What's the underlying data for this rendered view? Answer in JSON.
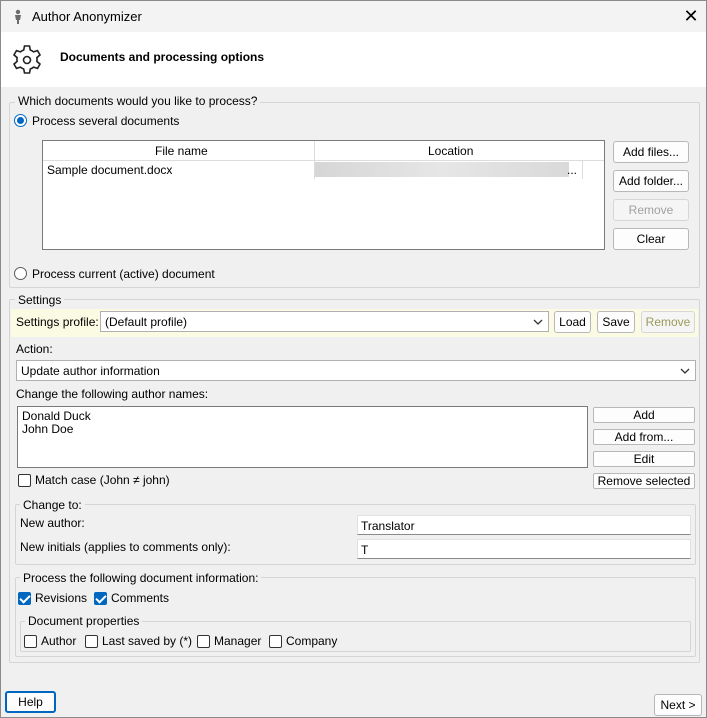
{
  "window": {
    "title": "Author Anonymizer",
    "close_glyph": "✕"
  },
  "header": {
    "title": "Documents and processing options",
    "icon": "gear-icon"
  },
  "docs_group": {
    "label": "Which documents would you like to process?",
    "option_several": "Process several documents",
    "option_current": "Process current (active) document",
    "table": {
      "columns": [
        "File name",
        "Location"
      ],
      "rows": [
        {
          "file": "Sample document.docx",
          "location_suffix": "..."
        }
      ]
    },
    "buttons": {
      "add_files": "Add files...",
      "add_folder": "Add folder...",
      "remove": "Remove",
      "clear": "Clear"
    }
  },
  "settings_group": {
    "label": "Settings",
    "profile_label": "Settings profile:",
    "profile_value": "(Default profile)",
    "load": "Load",
    "save": "Save",
    "remove": "Remove",
    "action_label": "Action:",
    "action_value": "Update author information",
    "names_label": "Change the following author names:",
    "names": [
      "Donald Duck",
      "John Doe"
    ],
    "names_buttons": {
      "add": "Add",
      "add_from": "Add from...",
      "edit": "Edit",
      "remove_selected": "Remove selected"
    },
    "match_case": "Match case (John ≠ john)"
  },
  "change_to": {
    "label": "Change to:",
    "new_author_label": "New author:",
    "new_author_value": "Translator",
    "new_initials_label": "New initials (applies to comments only):",
    "new_initials_value": "T"
  },
  "process_info": {
    "label": "Process the following document information:",
    "revisions": "Revisions",
    "comments": "Comments",
    "doc_props_label": "Document properties",
    "author": "Author",
    "last_saved_by": "Last saved by (*)",
    "manager": "Manager",
    "company": "Company"
  },
  "footer": {
    "help": "Help",
    "next": "Next >"
  },
  "colors": {
    "accent": "#0067c0",
    "highlight_row": "#fbfbe3"
  }
}
